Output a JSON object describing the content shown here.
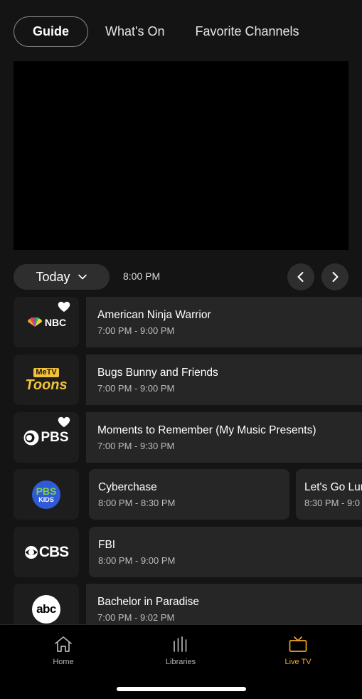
{
  "tabs": [
    {
      "label": "Guide",
      "active": true
    },
    {
      "label": "What's On",
      "active": false
    },
    {
      "label": "Favorite Channels",
      "active": false
    }
  ],
  "day_selector": {
    "label": "Today"
  },
  "time_marker": "8:00 PM",
  "channels": [
    {
      "name": "NBC",
      "logo_text": "NBC",
      "favorite": true,
      "programs": [
        {
          "title": "American Ninja Warrior",
          "time": "7:00 PM - 9:00 PM"
        }
      ]
    },
    {
      "name": "MeTV Toons",
      "logo_text_top": "MeTV",
      "logo_text_bottom": "Toons",
      "favorite": false,
      "programs": [
        {
          "title": "Bugs Bunny and Friends",
          "time": "7:00 PM - 9:00 PM"
        }
      ]
    },
    {
      "name": "PBS",
      "logo_text": "PBS",
      "favorite": true,
      "programs": [
        {
          "title": "Moments to Remember (My Music Presents)",
          "time": "7:00 PM - 9:30 PM"
        }
      ]
    },
    {
      "name": "PBS KIDS",
      "logo_text_top": "PBS",
      "logo_text_bottom": "KIDS",
      "favorite": false,
      "programs": [
        {
          "title": "Cyberchase",
          "time": "8:00 PM - 8:30 PM"
        },
        {
          "title": "Let's Go Lur",
          "time": "8:30 PM - 9:0"
        }
      ]
    },
    {
      "name": "CBS",
      "logo_text": "CBS",
      "favorite": false,
      "programs": [
        {
          "title": "FBI",
          "time": "8:00 PM - 9:00 PM"
        }
      ]
    },
    {
      "name": "ABC",
      "logo_text": "abc",
      "favorite": false,
      "programs": [
        {
          "title": "Bachelor in Paradise",
          "time": "7:00 PM - 9:02 PM"
        }
      ]
    }
  ],
  "bottom_nav": [
    {
      "label": "Home",
      "icon": "home-icon",
      "active": false
    },
    {
      "label": "Libraries",
      "icon": "libraries-icon",
      "active": false
    },
    {
      "label": "Live TV",
      "icon": "tv-icon",
      "active": true
    }
  ],
  "colors": {
    "accent": "#f5a623",
    "background": "#141414",
    "card": "#262626"
  }
}
